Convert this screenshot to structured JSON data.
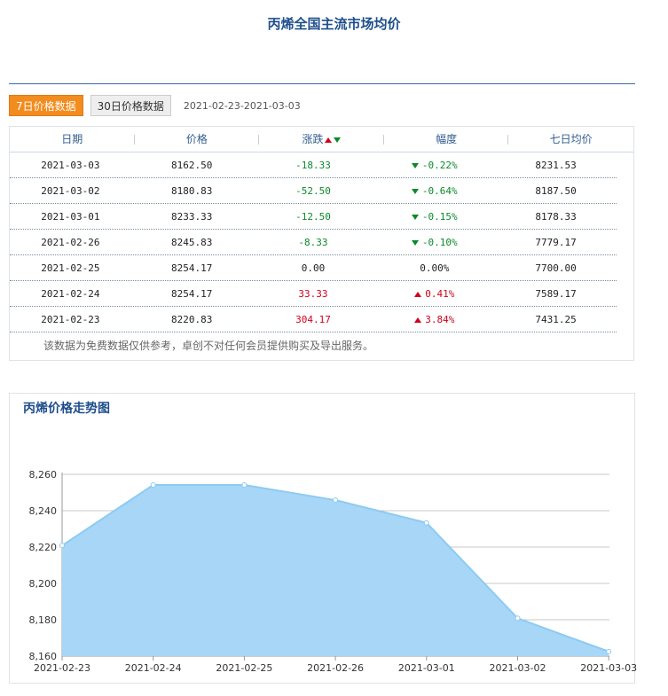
{
  "page_title": "丙烯全国主流市场均价",
  "tabs": [
    {
      "label": "7日价格数据",
      "active": true
    },
    {
      "label": "30日价格数据",
      "active": false
    }
  ],
  "date_range": "2021-02-23-2021-03-03",
  "table": {
    "headers": [
      "日期",
      "价格",
      "涨跌",
      "幅度",
      "七日均价"
    ],
    "rows": [
      {
        "date": "2021-03-03",
        "price": "8162.50",
        "change": "-18.33",
        "pct": "-0.22%",
        "avg7": "8231.53",
        "dir": "down"
      },
      {
        "date": "2021-03-02",
        "price": "8180.83",
        "change": "-52.50",
        "pct": "-0.64%",
        "avg7": "8187.50",
        "dir": "down"
      },
      {
        "date": "2021-03-01",
        "price": "8233.33",
        "change": "-12.50",
        "pct": "-0.15%",
        "avg7": "8178.33",
        "dir": "down"
      },
      {
        "date": "2021-02-26",
        "price": "8245.83",
        "change": "-8.33",
        "pct": "-0.10%",
        "avg7": "7779.17",
        "dir": "down"
      },
      {
        "date": "2021-02-25",
        "price": "8254.17",
        "change": "0.00",
        "pct": "0.00%",
        "avg7": "7700.00",
        "dir": "flat"
      },
      {
        "date": "2021-02-24",
        "price": "8254.17",
        "change": "33.33",
        "pct": "0.41%",
        "avg7": "7589.17",
        "dir": "up"
      },
      {
        "date": "2021-02-23",
        "price": "8220.83",
        "change": "304.17",
        "pct": "3.84%",
        "avg7": "7431.25",
        "dir": "up"
      }
    ],
    "note": "该数据为免费数据仅供参考，卓创不对任何会员提供购买及导出服务。"
  },
  "colors": {
    "up": "#d0021b",
    "down": "#0a8a2a",
    "area_fill": "#a8d6f7",
    "area_line": "#8ccbf2",
    "accent": "#f28c1e"
  },
  "chart_data": {
    "type": "area",
    "title": "丙烯价格走势图",
    "categories": [
      "2021-02-23",
      "2021-02-24",
      "2021-02-25",
      "2021-02-26",
      "2021-03-01",
      "2021-03-02",
      "2021-03-03"
    ],
    "series": [
      {
        "values": [
          8220.83,
          8254.17,
          8254.17,
          8245.83,
          8233.33,
          8180.83,
          8162.5
        ]
      }
    ],
    "ylim": [
      8160,
      8260
    ],
    "yticks": [
      8160,
      8180,
      8200,
      8220,
      8240,
      8260
    ],
    "ytick_labels": [
      "8,160",
      "8,180",
      "8,200",
      "8,220",
      "8,240",
      "8,260"
    ],
    "grid": true,
    "xlabel": "",
    "ylabel": ""
  }
}
